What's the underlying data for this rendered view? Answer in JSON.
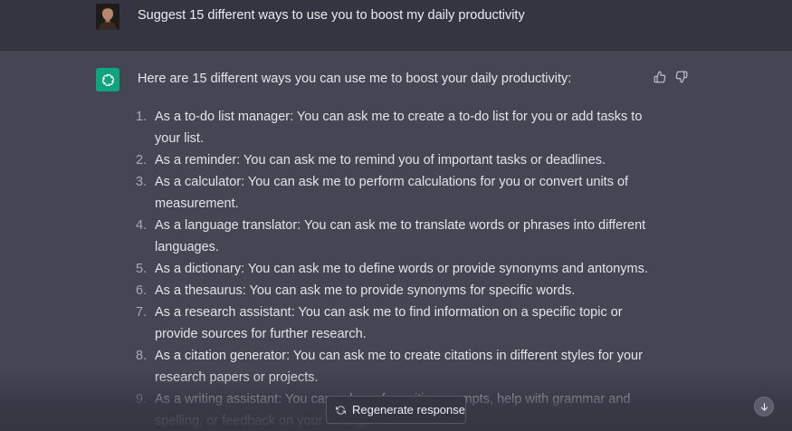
{
  "user_message": {
    "text": "Suggest 15 different ways to use you to boost my daily productivity"
  },
  "assistant_message": {
    "intro": "Here are 15 different ways you can use me to boost your daily productivity:",
    "items": [
      {
        "number": "1.",
        "lines": [
          "As a to-do list manager: You can ask me to create a to-do list for you or add tasks to",
          "your list."
        ]
      },
      {
        "number": "2.",
        "lines": [
          "As a reminder: You can ask me to remind you of important tasks or deadlines."
        ]
      },
      {
        "number": "3.",
        "lines": [
          "As a calculator: You can ask me to perform calculations for you or convert units of",
          "measurement."
        ]
      },
      {
        "number": "4.",
        "lines": [
          "As a language translator: You can ask me to translate words or phrases into different",
          "languages."
        ]
      },
      {
        "number": "5.",
        "lines": [
          "As a dictionary: You can ask me to define words or provide synonyms and antonyms."
        ]
      },
      {
        "number": "6.",
        "lines": [
          "As a thesaurus: You can ask me to provide synonyms for specific words."
        ]
      },
      {
        "number": "7.",
        "lines": [
          "As a research assistant: You can ask me to find information on a specific topic or",
          "provide sources for further research."
        ]
      },
      {
        "number": "8.",
        "lines": [
          "As a citation generator: You can ask me to create citations in different styles for your",
          "research papers or projects."
        ]
      },
      {
        "number": "9.",
        "lines": [
          "As a writing assistant: You can ask me for writing prompts, help with grammar and",
          "spelling, or feedback on your writing."
        ]
      }
    ]
  },
  "controls": {
    "regenerate_label": "Regenerate response"
  },
  "icons": {
    "thumbs_up": "thumbs-up-icon",
    "thumbs_down": "thumbs-down-icon",
    "regenerate": "refresh-icon",
    "scroll_down": "arrow-down-icon",
    "assistant_logo": "openai-logo-icon"
  },
  "colors": {
    "user_row_bg": "#343541",
    "assistant_row_bg": "#444654",
    "logo_green": "#10a37f"
  }
}
